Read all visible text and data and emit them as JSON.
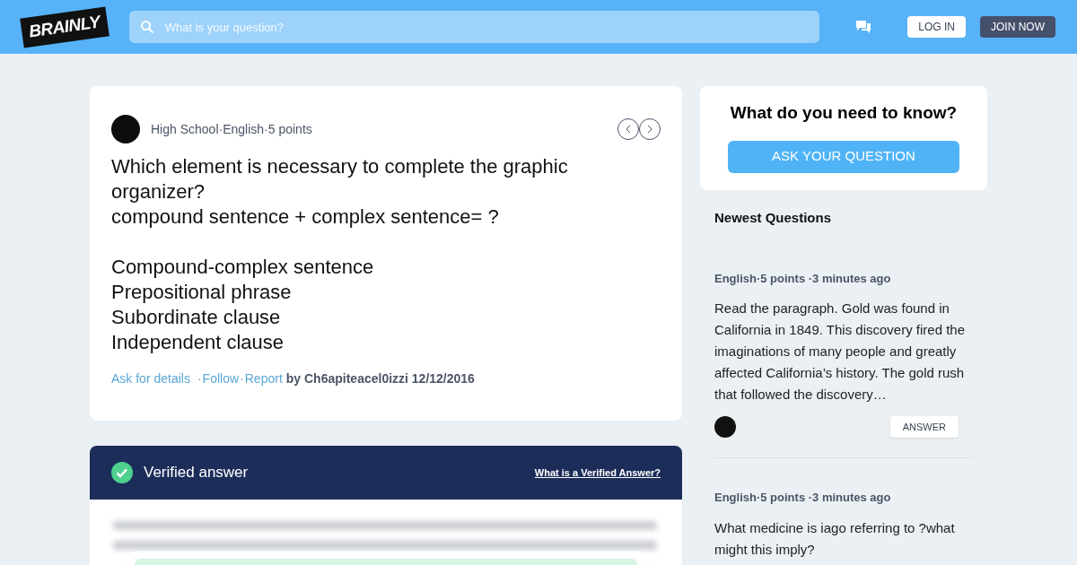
{
  "header": {
    "logo": "BRAINLY",
    "search": {
      "placeholder": "What is your question?"
    },
    "login": "LOG IN",
    "join": "JOIN NOW"
  },
  "question": {
    "meta": "High School·English·5 points",
    "paragraphs": [
      [
        "Which element is necessary to complete the graphic organizer?",
        "compound sentence + complex sentence= ?"
      ],
      [
        "Compound-complex sentence",
        "Prepositional phrase",
        "Subordinate clause",
        "Independent clause"
      ]
    ],
    "links": [
      {
        "kind": "link",
        "text": "Ask for details"
      },
      {
        "kind": "separator",
        "text": "·"
      },
      {
        "kind": "link",
        "text": "Follow"
      },
      {
        "kind": "separator",
        "text": "·"
      },
      {
        "kind": "link",
        "text": "Report"
      }
    ],
    "byline": "by Ch6apiteacel0izzi 12/12/2016"
  },
  "answer": {
    "title": "Verified answer",
    "help_link": "What is a Verified Answer?"
  },
  "ask_card": {
    "title": "What do you need to know?",
    "button": "ASK YOUR QUESTION"
  },
  "newest": {
    "title": "Newest Questions",
    "items": [
      {
        "meta": "English·5 points ·3 minutes ago",
        "text": "Read the paragraph. Gold was found in California in 1849. This discovery fired the imaginations of many people and greatly affected California’s history. The gold rush that followed the discovery…",
        "button": "ANSWER"
      },
      {
        "meta": "English·5 points ·3 minutes ago",
        "text": "What medicine is iago referring to ?what might this imply?"
      }
    ]
  }
}
